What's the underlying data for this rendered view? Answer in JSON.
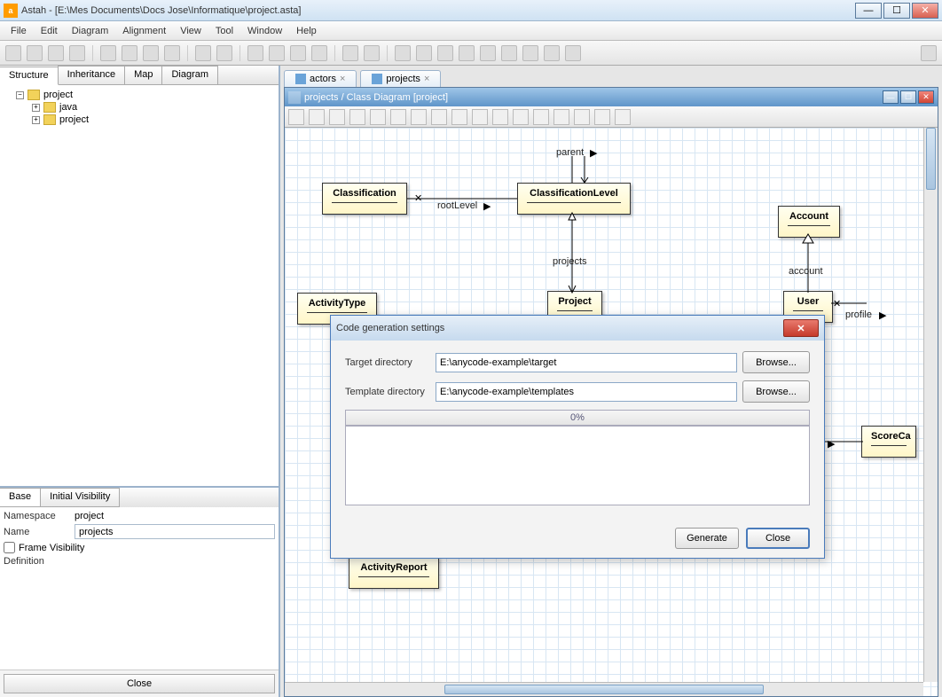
{
  "title": "Astah - [E:\\Mes Documents\\Docs Jose\\Informatique\\project.asta]",
  "menu": [
    "File",
    "Edit",
    "Diagram",
    "Alignment",
    "View",
    "Tool",
    "Window",
    "Help"
  ],
  "left_tabs": [
    "Structure",
    "Inheritance",
    "Map",
    "Diagram"
  ],
  "tree": {
    "root": "project",
    "children": [
      "java",
      "project"
    ]
  },
  "prop_tabs": [
    "Base",
    "Initial Visibility"
  ],
  "props": {
    "namespace_label": "Namespace",
    "namespace": "project",
    "name_label": "Name",
    "name": "projects",
    "frame_vis_label": "Frame Visibility",
    "def_label": "Definition"
  },
  "left_close": "Close",
  "doc_tabs": [
    {
      "label": "actors"
    },
    {
      "label": "projects"
    }
  ],
  "doc_window_title": "projects / Class Diagram [project]",
  "uml": {
    "classification": "Classification",
    "classification_level": "ClassificationLevel",
    "account": "Account",
    "activity_type": "ActivityType",
    "project": "Project",
    "user": "User",
    "score_card": "ScoreCa",
    "activity_report": "ActivityReport",
    "parent": "parent",
    "root_level": "rootLevel",
    "projects": "projects",
    "account_lbl": "account",
    "profile": "profile"
  },
  "dialog": {
    "title": "Code generation settings",
    "target_label": "Target directory",
    "target_value": "E:\\anycode-example\\target",
    "template_label": "Template directory",
    "template_value": "E:\\anycode-example\\templates",
    "browse": "Browse...",
    "progress": "0%",
    "generate": "Generate",
    "close": "Close"
  }
}
